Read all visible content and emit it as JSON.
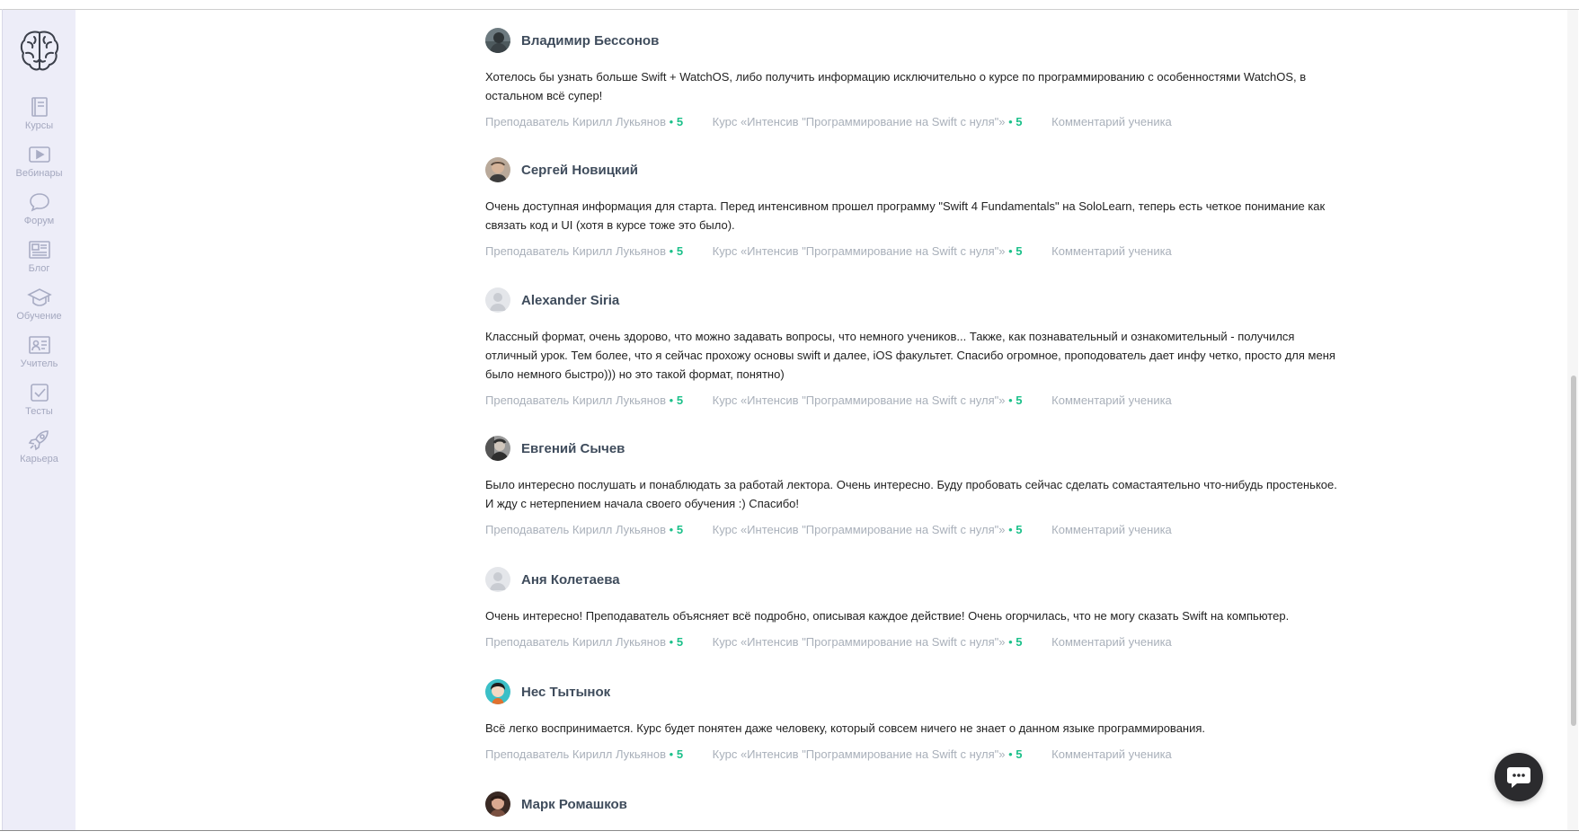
{
  "sidebar": {
    "items": [
      {
        "label": "Курсы",
        "icon": "book-icon"
      },
      {
        "label": "Вебинары",
        "icon": "video-play-icon"
      },
      {
        "label": "Форум",
        "icon": "speech-bubble-icon"
      },
      {
        "label": "Блог",
        "icon": "newspaper-icon"
      },
      {
        "label": "Обучение",
        "icon": "graduation-cap-icon"
      },
      {
        "label": "Учитель",
        "icon": "teacher-board-icon"
      },
      {
        "label": "Тесты",
        "icon": "checkbox-icon"
      },
      {
        "label": "Карьера",
        "icon": "rocket-icon"
      }
    ]
  },
  "colors": {
    "accent": "#1cc08a",
    "sidebar_bg": "#ededf8",
    "author": "#3f4c5c",
    "meta": "#a9b0ba"
  },
  "reviews": [
    {
      "author": "Владимир Бессонов",
      "text": "Хотелось бы узнать больше Swift + WatchOS, либо получить информацию исключительно о курсе по программированию с особенностями WatchOS, в остальном всё супер!",
      "teacher": "Преподаватель Кирилл Лукьянов",
      "teacher_rating": "5",
      "course": "Курс «Интенсив \"Программирование на Swift с нуля\"»",
      "course_rating": "5",
      "kind": "Комментарий ученика"
    },
    {
      "author": "Сергей Новицкий",
      "text": "Очень доступная информация для старта. Перед интенсивном прошел программу \"Swift 4 Fundamentals\" на SoloLearn, теперь есть четкое понимание как связать код и UI (хотя в курсе тоже это было).",
      "teacher": "Преподаватель Кирилл Лукьянов",
      "teacher_rating": "5",
      "course": "Курс «Интенсив \"Программирование на Swift с нуля\"»",
      "course_rating": "5",
      "kind": "Комментарий ученика"
    },
    {
      "author": "Alexander Siria",
      "text": "Классный формат, очень здорово, что можно задавать вопросы, что немного учеников... Также, как познавательный и ознакомительный - получился отличный урок. Тем более, что я сейчас прохожу основы swift и далее, iOS факультет. Спасибо огромное, проподователь дает инфу четко, просто для меня было немного быстро))) но это такой формат, понятно)",
      "teacher": "Преподаватель Кирилл Лукьянов",
      "teacher_rating": "5",
      "course": "Курс «Интенсив \"Программирование на Swift с нуля\"»",
      "course_rating": "5",
      "kind": "Комментарий ученика"
    },
    {
      "author": "Евгений Сычев",
      "text": "Было интересно послушать и понаблюдать за работай лектора. Очень интересно. Буду пробовать сейчас сделать сомастаятельно что-нибудь простенькое. И жду с нетерпением начала своего обучения :) Спасибо!",
      "teacher": "Преподаватель Кирилл Лукьянов",
      "teacher_rating": "5",
      "course": "Курс «Интенсив \"Программирование на Swift с нуля\"»",
      "course_rating": "5",
      "kind": "Комментарий ученика"
    },
    {
      "author": "Аня Колетаева",
      "text": "Очень интересно! Преподаватель объясняет всё подробно, описывая каждое действие! Очень огорчилась, что не могу сказать Swift на компьютер.",
      "teacher": "Преподаватель Кирилл Лукьянов",
      "teacher_rating": "5",
      "course": "Курс «Интенсив \"Программирование на Swift с нуля\"»",
      "course_rating": "5",
      "kind": "Комментарий ученика"
    },
    {
      "author": "Нес Тытынок",
      "text": "Всё легко воспринимается. Курс будет понятен даже человеку, который совсем ничего не знает о данном языке программирования.",
      "teacher": "Преподаватель Кирилл Лукьянов",
      "teacher_rating": "5",
      "course": "Курс «Интенсив \"Программирование на Swift с нуля\"»",
      "course_rating": "5",
      "kind": "Комментарий ученика"
    },
    {
      "author": "Марк Ромашков"
    }
  ]
}
